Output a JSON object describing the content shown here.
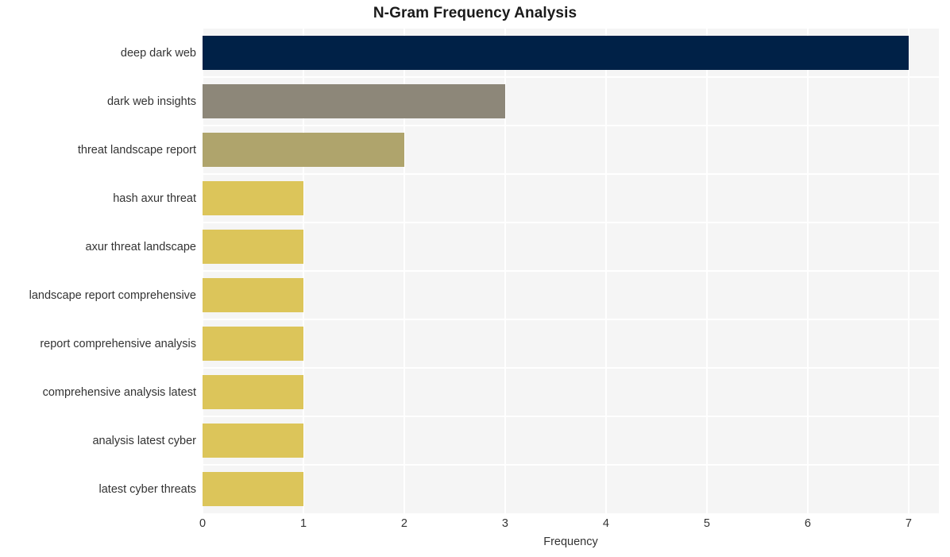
{
  "chart_data": {
    "type": "bar",
    "orientation": "horizontal",
    "title": "N-Gram Frequency Analysis",
    "xlabel": "Frequency",
    "ylabel": "",
    "xlim": [
      0,
      7.3
    ],
    "xticks": [
      "0",
      "1",
      "2",
      "3",
      "4",
      "5",
      "6",
      "7"
    ],
    "xtick_values": [
      0,
      1,
      2,
      3,
      4,
      5,
      6,
      7
    ],
    "grid": true,
    "legend": "none",
    "categories": [
      "deep dark web",
      "dark web insights",
      "threat landscape report",
      "hash axur threat",
      "axur threat landscape",
      "landscape report comprehensive",
      "report comprehensive analysis",
      "comprehensive analysis latest",
      "analysis latest cyber",
      "latest cyber threats"
    ],
    "values": [
      7,
      3,
      2,
      1,
      1,
      1,
      1,
      1,
      1,
      1
    ],
    "bar_colors": [
      "#002147",
      "#8d8779",
      "#afa46c",
      "#dcc55a",
      "#dcc55a",
      "#dcc55a",
      "#dcc55a",
      "#dcc55a",
      "#dcc55a",
      "#dcc55a"
    ],
    "plot_background": "#f5f5f5",
    "gridline_color": "#ffffff",
    "figure_background": "#ffffff"
  }
}
